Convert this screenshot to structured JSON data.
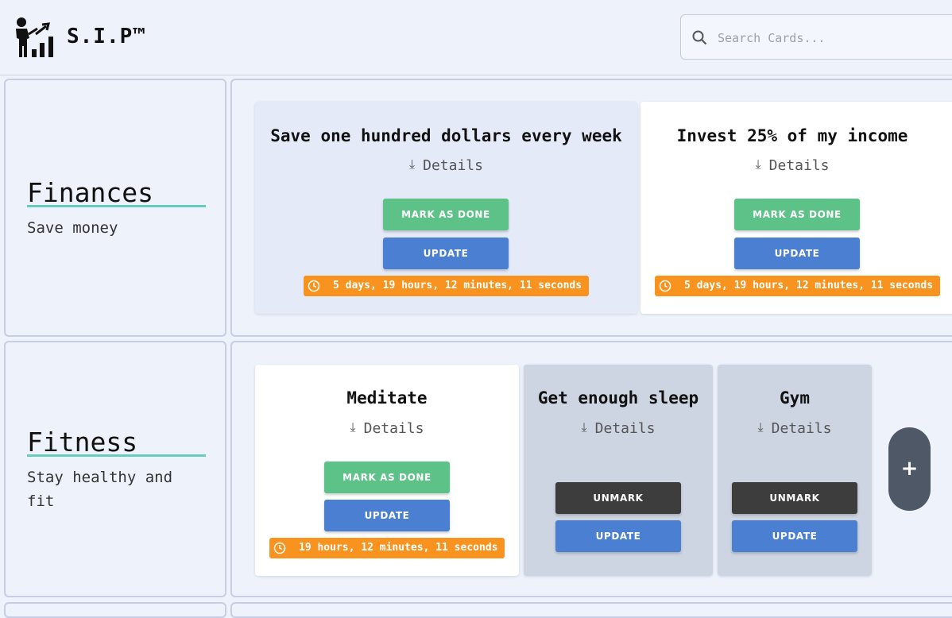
{
  "header": {
    "brand": "S.I.P™",
    "logo_icon": "person-growth-chart-icon",
    "search_placeholder": "Search Cards..."
  },
  "colors": {
    "mark_done": "#5cc287",
    "update": "#4b7fd2",
    "unmark": "#3d3d3d",
    "timer": "#f7931e",
    "accent_underline": "#67cbc0",
    "fab": "#4e5866"
  },
  "categories": [
    {
      "title": "Finances",
      "description": "Save money",
      "cards": [
        {
          "title": "Save one hundred dollars every week",
          "details": "Details",
          "primary": "MARK AS DONE",
          "update": "UPDATE",
          "timer": "5 days, 19 hours, 12 minutes, 11 seconds",
          "state": "active"
        },
        {
          "title": "Invest 25% of my income",
          "details": "Details",
          "primary": "MARK AS DONE",
          "update": "UPDATE",
          "timer": "5 days, 19 hours, 12 minutes, 11 seconds",
          "state": "active"
        }
      ]
    },
    {
      "title": "Fitness",
      "description": "Stay healthy and fit",
      "cards": [
        {
          "title": "Meditate",
          "details": "Details",
          "primary": "MARK AS DONE",
          "update": "UPDATE",
          "timer": "19 hours, 12 minutes, 11 seconds",
          "state": "active"
        },
        {
          "title": "Get enough sleep",
          "details": "Details",
          "primary": "UNMARK",
          "update": "UPDATE",
          "state": "done"
        },
        {
          "title": "Gym",
          "details": "Details",
          "primary": "UNMARK",
          "update": "UPDATE",
          "state": "done"
        }
      ],
      "add_button": "+"
    }
  ]
}
